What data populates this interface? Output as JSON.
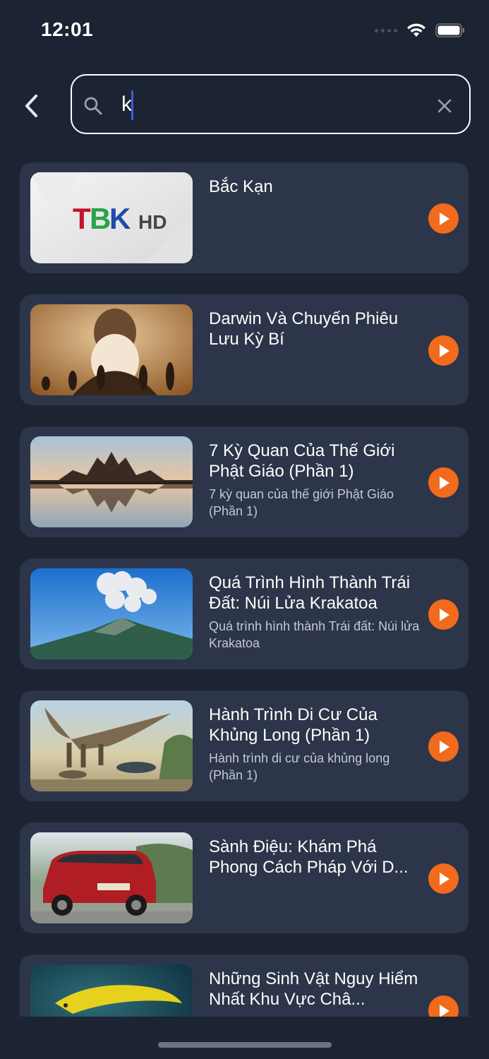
{
  "status_bar": {
    "time": "12:01"
  },
  "search": {
    "value": "k",
    "placeholder": ""
  },
  "colors": {
    "background": "#1c2333",
    "card": "#2c3549",
    "accent": "#f26a1b"
  },
  "icons": {
    "back": "chevron-left-icon",
    "search": "search-icon",
    "clear": "close-icon",
    "play": "play-icon"
  },
  "results": [
    {
      "title": "Bắc Kạn",
      "subtitle": "",
      "thumbnail": "tbk-hd-logo",
      "logo_text": "TBK HD"
    },
    {
      "title": "Darwin Và Chuyến Phiêu Lưu Kỳ Bí",
      "subtitle": "",
      "thumbnail": "darwin-evolution"
    },
    {
      "title": "7 Kỳ Quan Của Thế Giới Phật Giáo (Phần 1)",
      "subtitle": "7 kỳ quan của thế giới Phật Giáo (Phần 1)",
      "thumbnail": "angkor-temple-reflection"
    },
    {
      "title": "Quá Trình Hình Thành Trái Đất: Núi Lửa Krakatoa",
      "subtitle": "Quá trình hình thành Trái đất: Núi lửa Krakatoa",
      "thumbnail": "volcano-eruption"
    },
    {
      "title": "Hành Trình Di Cư Của Khủng Long (Phần 1)",
      "subtitle": "Hành trình di cư của khủng long (Phần 1)",
      "thumbnail": "dinosaurs"
    },
    {
      "title": "Sành Điệu: Khám Phá Phong Cách Pháp Với D...",
      "subtitle": "",
      "thumbnail": "red-suv"
    },
    {
      "title": "Những Sinh Vật Nguy Hiểm Nhất Khu Vực Châ...",
      "subtitle": "",
      "thumbnail": "yellow-eel"
    }
  ]
}
